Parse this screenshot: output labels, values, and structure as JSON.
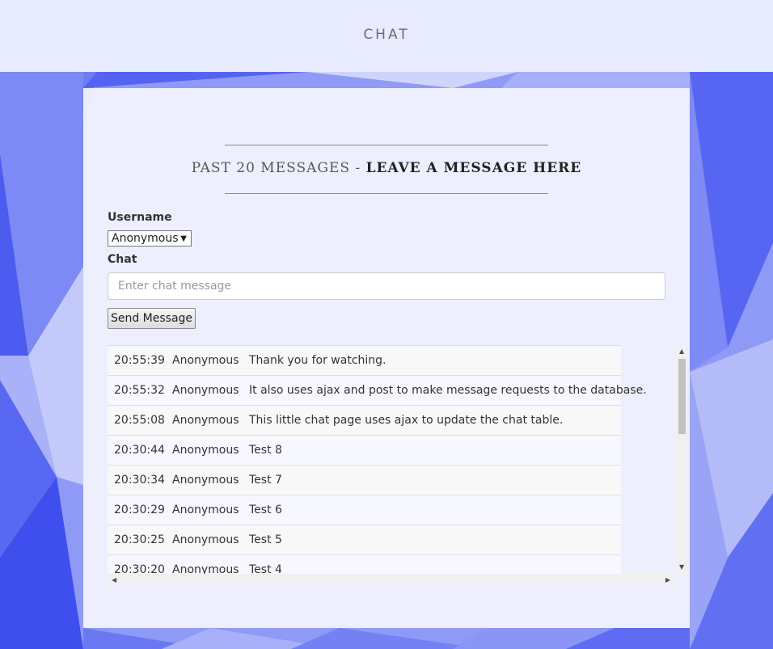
{
  "header": {
    "title": "CHAT"
  },
  "panel": {
    "heading_light": "PAST 20 MESSAGES - ",
    "heading_bold": "LEAVE A MESSAGE HERE"
  },
  "form": {
    "username_label": "Username",
    "username_value": "Anonymous",
    "chat_label": "Chat",
    "chat_placeholder": "Enter chat message",
    "send_label": "Send Message"
  },
  "messages": [
    {
      "time": "20:55:39",
      "user": "Anonymous",
      "text": "Thank you for watching."
    },
    {
      "time": "20:55:32",
      "user": "Anonymous",
      "text": "It also uses ajax and post to make message requests to the database."
    },
    {
      "time": "20:55:08",
      "user": "Anonymous",
      "text": "This little chat page uses ajax to update the chat table."
    },
    {
      "time": "20:30:44",
      "user": "Anonymous",
      "text": "Test 8"
    },
    {
      "time": "20:30:34",
      "user": "Anonymous",
      "text": "Test 7"
    },
    {
      "time": "20:30:29",
      "user": "Anonymous",
      "text": "Test 6"
    },
    {
      "time": "20:30:25",
      "user": "Anonymous",
      "text": "Test 5"
    },
    {
      "time": "20:30:20",
      "user": "Anonymous",
      "text": "Test 4"
    }
  ],
  "icons": {
    "dropdown": "triangle-down-icon",
    "scroll_up": "triangle-up-icon",
    "scroll_down": "triangle-down-icon",
    "scroll_left": "triangle-left-icon",
    "scroll_right": "triangle-right-icon"
  },
  "colors": {
    "background_accent": "#4f5ef5",
    "panel": "#f8f8ff"
  }
}
